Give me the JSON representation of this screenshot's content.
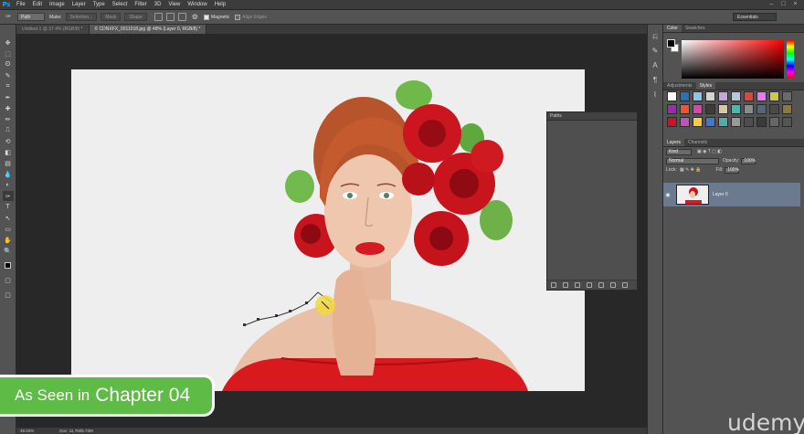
{
  "app": {
    "logo": "Ps"
  },
  "menu": [
    "File",
    "Edit",
    "Image",
    "Layer",
    "Type",
    "Select",
    "Filter",
    "3D",
    "View",
    "Window",
    "Help"
  ],
  "window_controls": [
    "–",
    "□",
    "×"
  ],
  "options": {
    "mode_value": "Path",
    "make_label": "Make:",
    "selection_btn": "Selection...",
    "mask_btn": "Mask",
    "shape_btn": "Shape",
    "magnetic_label": "Magnetic",
    "align_edges_label": "Align Edges",
    "workspace": "Essentials"
  },
  "tabs": [
    {
      "label": "Untitled-1 @ 37.4% (RGB/8) *",
      "active": false
    },
    {
      "label": "© CDNXFX_0011018.jpg @ 48% (Layer 0, RGB/8) *",
      "active": true
    }
  ],
  "tools": [
    "move-icon",
    "marquee-icon",
    "lasso-icon",
    "quick-select-icon",
    "crop-icon",
    "eyedropper-icon",
    "healing-icon",
    "brush-icon",
    "stamp-icon",
    "history-brush-icon",
    "eraser-icon",
    "gradient-icon",
    "blur-icon",
    "dodge-icon",
    "pen-icon",
    "type-icon",
    "path-select-icon",
    "shape-icon",
    "hand-icon",
    "zoom-icon"
  ],
  "tool_glyphs": [
    "✥",
    "⬚",
    "ʘ",
    "✎",
    "⌗",
    "✒",
    "✚",
    "✏",
    "⎍",
    "⟲",
    "◧",
    "▤",
    "💧",
    "◐",
    "✑",
    "T",
    "↖",
    "▭",
    "✋",
    "🔍"
  ],
  "status": {
    "zoom": "48.02%",
    "doc": "Doc: 11.7M/5.72M"
  },
  "paths_panel": {
    "title": "Paths"
  },
  "right_panel": {
    "color_tabs": [
      "Color",
      "Swatches"
    ],
    "adjust_tabs": [
      "Adjustments",
      "Styles"
    ],
    "layer_tabs": [
      "Layers",
      "Channels"
    ],
    "kind_label": "Kind",
    "blend_mode": "Normal",
    "opacity_label": "Opacity:",
    "opacity_value": "100%",
    "lock_label": "Lock:",
    "fill_label": "Fill:",
    "fill_value": "100%",
    "layer_name": "Layer 0"
  },
  "styles_swatches": [
    "#ffffff",
    "#2f6db5",
    "#8fc3e8",
    "#d4d4d4",
    "#c8a6d8",
    "#b3c9d9",
    "#d44",
    "#e7e",
    "#cc4",
    "#6a6a6a",
    "#a2b",
    "#e53",
    "#d4a",
    "#3b3b3b",
    "#d8c8a8",
    "#4ba",
    "#8c8c8c",
    "#567",
    "#4a4a4a",
    "#8a7a3a",
    "#c13",
    "#b5b",
    "#fc3",
    "#47c",
    "#5aa",
    "#999",
    "#4e4e4e",
    "#3a3a3a",
    "#666",
    "#555"
  ],
  "badge": {
    "prefix": "As Seen in",
    "chapter": "Chapter 04"
  },
  "watermark": "udemy"
}
